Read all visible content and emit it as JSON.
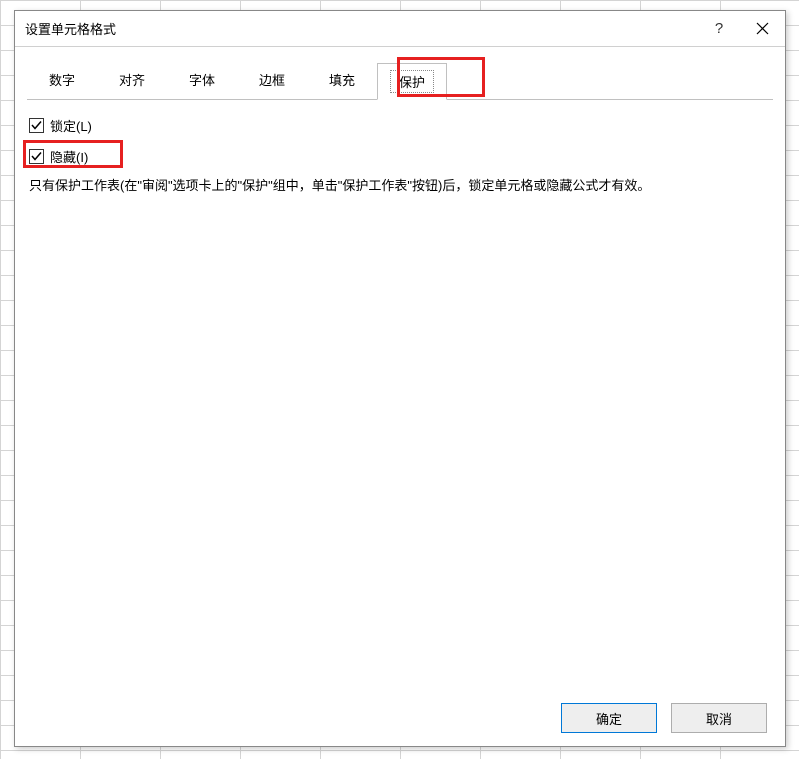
{
  "dialog": {
    "title": "设置单元格格式"
  },
  "tabs": {
    "number": "数字",
    "alignment": "对齐",
    "font": "字体",
    "border": "边框",
    "fill": "填充",
    "protection": "保护"
  },
  "protection": {
    "locked_label": "锁定(L)",
    "locked_checked": true,
    "hidden_label": "隐藏(I)",
    "hidden_checked": true,
    "help_text": "只有保护工作表(在\"审阅\"选项卡上的\"保护\"组中，单击\"保护工作表\"按钮)后，锁定单元格或隐藏公式才有效。"
  },
  "buttons": {
    "ok": "确定",
    "cancel": "取消"
  }
}
